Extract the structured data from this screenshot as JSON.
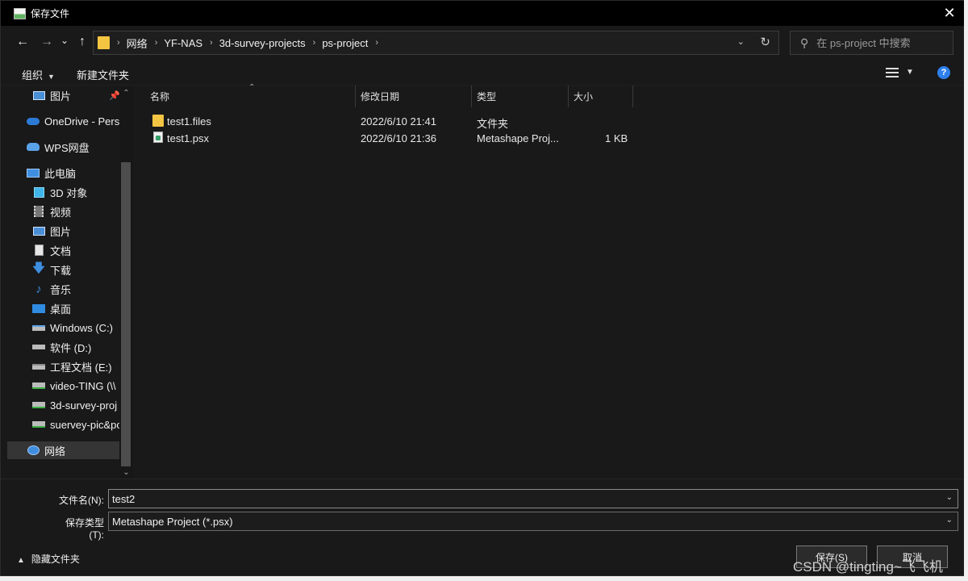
{
  "window": {
    "title": "保存文件",
    "close_glyph": "✕"
  },
  "nav": {
    "back": "←",
    "forward": "→",
    "recent": "⌄",
    "up": "↑",
    "breadcrumb": [
      "网络",
      "YF-NAS",
      "3d-survey-projects",
      "ps-project"
    ],
    "separator": "›",
    "search_placeholder": "在 ps-project 中搜索"
  },
  "toolbar": {
    "organize": "组织",
    "new_folder": "新建文件夹",
    "help": "?"
  },
  "sidebar": {
    "items": [
      {
        "label": "图片",
        "icon": "picture-icon",
        "indent": 1
      },
      {
        "label": "OneDrive - Perso",
        "icon": "onedrive-icon",
        "indent": 0
      },
      {
        "label": "WPS网盘",
        "icon": "wps-cloud-icon",
        "indent": 0
      },
      {
        "label": "此电脑",
        "icon": "computer-icon",
        "indent": 0
      },
      {
        "label": "3D 对象",
        "icon": "cube-icon",
        "indent": 1
      },
      {
        "label": "视频",
        "icon": "video-icon",
        "indent": 1
      },
      {
        "label": "图片",
        "icon": "picture-icon",
        "indent": 1
      },
      {
        "label": "文档",
        "icon": "document-icon",
        "indent": 1
      },
      {
        "label": "下载",
        "icon": "download-icon",
        "indent": 1
      },
      {
        "label": "音乐",
        "icon": "music-icon",
        "indent": 1
      },
      {
        "label": "桌面",
        "icon": "desktop-icon",
        "indent": 1
      },
      {
        "label": "Windows (C:)",
        "icon": "drive-icon",
        "indent": 1
      },
      {
        "label": "软件 (D:)",
        "icon": "drive-icon",
        "indent": 1
      },
      {
        "label": "工程文档 (E:)",
        "icon": "drive-icon",
        "indent": 1
      },
      {
        "label": "video-TING (\\\\",
        "icon": "network-drive-icon",
        "indent": 1
      },
      {
        "label": "3d-survey-proj",
        "icon": "network-drive-icon",
        "indent": 1
      },
      {
        "label": "suervey-pic&pc",
        "icon": "network-drive-icon",
        "indent": 1
      },
      {
        "label": "网络",
        "icon": "network-icon",
        "indent": 0,
        "selected": true
      }
    ]
  },
  "filelist": {
    "columns": [
      "名称",
      "修改日期",
      "类型",
      "大小"
    ],
    "rows": [
      {
        "name": "test1.files",
        "date": "2022/6/10 21:41",
        "type": "文件夹",
        "size": "",
        "icon": "folder-icon"
      },
      {
        "name": "test1.psx",
        "date": "2022/6/10 21:36",
        "type": "Metashape Proj...",
        "size": "1 KB",
        "icon": "psx-file-icon"
      }
    ]
  },
  "bottom": {
    "filename_label": "文件名(N):",
    "filename_value": "test2",
    "filetype_label": "保存类型(T):",
    "filetype_value": "Metashape Project (*.psx)",
    "hide_folders": "隐藏文件夹",
    "save_button": "保存(S)",
    "cancel_button": "取消"
  },
  "watermark": "CSDN @tingting~飞飞机"
}
